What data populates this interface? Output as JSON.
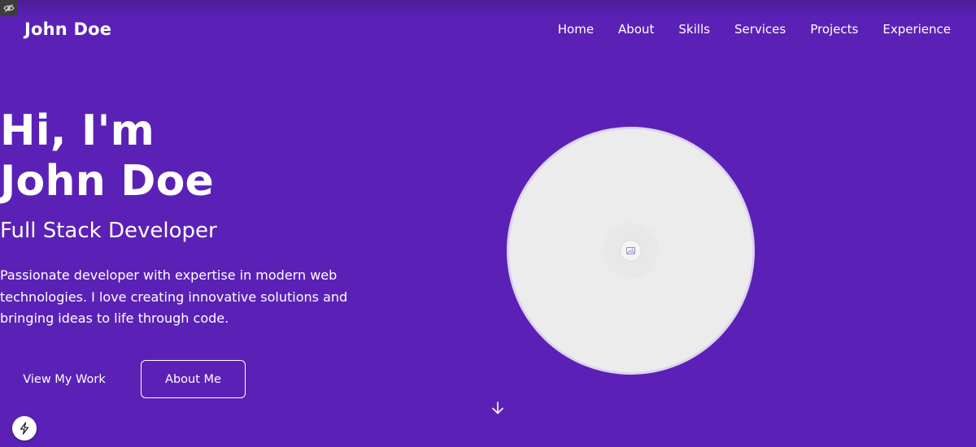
{
  "header": {
    "brand": "John Doe",
    "nav": [
      {
        "label": "Home"
      },
      {
        "label": "About"
      },
      {
        "label": "Skills"
      },
      {
        "label": "Services"
      },
      {
        "label": "Projects"
      },
      {
        "label": "Experience"
      }
    ]
  },
  "hero": {
    "greeting": "Hi, I'm",
    "name": "John Doe",
    "role": "Full Stack Developer",
    "description": "Passionate developer with expertise in modern web technologies. I love creating innovative solutions and bringing ideas to life through code.",
    "primary_button": "View My Work",
    "secondary_button": "About Me"
  },
  "avatar": {
    "icon": "image-placeholder-icon"
  },
  "icons": {
    "scroll": "arrow-down-icon",
    "fab": "lightning-icon",
    "devtools": "eye-off-icon"
  },
  "colors": {
    "background": "#5b21b6",
    "text": "#ffffff",
    "avatar_fill": "#ececec",
    "avatar_border": "#ddd3f0"
  }
}
